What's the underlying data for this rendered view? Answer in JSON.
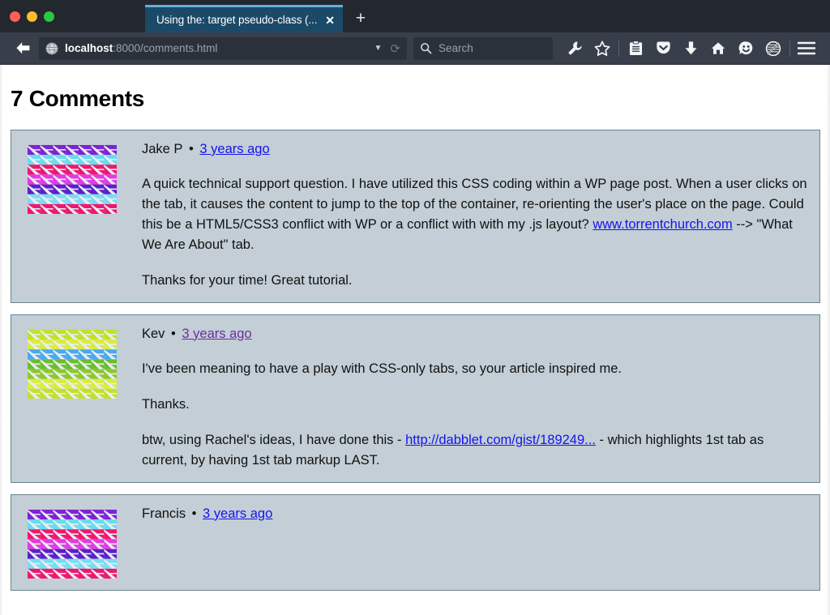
{
  "browser": {
    "traffic_lights": {
      "close_color": "#ff5f57",
      "minimize_color": "#febc2e",
      "maximize_color": "#28c840"
    },
    "tab": {
      "title": "Using the: target pseudo-class (...",
      "close_label": "✕",
      "accent_color": "#63b0db",
      "background_color": "#1b4a68"
    },
    "new_tab_label": "+",
    "back_icon": "back-arrow-icon",
    "url": {
      "host": "localhost",
      "path": ":8000/comments.html",
      "full": "localhost:8000/comments.html",
      "dropdown_icon": "▼",
      "reload_icon": "⟳"
    },
    "search": {
      "placeholder": "Search",
      "icon": "search-icon"
    },
    "toolbar_icons": [
      {
        "name": "wrench-icon",
        "glyph": "wrench"
      },
      {
        "name": "star-icon",
        "glyph": "star"
      },
      {
        "name": "reader-list-icon",
        "glyph": "clipboard"
      },
      {
        "name": "pocket-icon",
        "glyph": "pocket"
      },
      {
        "name": "downloads-icon",
        "glyph": "download-arrow"
      },
      {
        "name": "home-icon",
        "glyph": "home"
      },
      {
        "name": "smiley-feedback-icon",
        "glyph": "smiley"
      },
      {
        "name": "no-track-icon",
        "glyph": "circle-slash"
      },
      {
        "name": "menu-icon",
        "glyph": "hamburger"
      }
    ]
  },
  "page": {
    "title": "7 Comments",
    "comment_background": "#c3ced6",
    "comment_border": "#6b828f",
    "link_unvisited_color": "#1414ee",
    "link_visited_color": "#6b2fa0",
    "comments": [
      {
        "author": "Jake P",
        "separator": "•",
        "time_label": "3 years ago",
        "time_link_state": "unvisited",
        "avatar_name": "avatar-identicon-jake",
        "avatar_palette": [
          "#7d22d6",
          "#66dcf0",
          "#f0176f",
          "#e23be0",
          "#5c1fc9",
          "#7adcf2",
          "#f0176f"
        ],
        "paragraphs": [
          {
            "runs": [
              {
                "type": "text",
                "value": "A quick technical support question. I have utilized this CSS coding within a WP page post. When a user clicks on the tab, it causes the content to jump to the top of the container, re-orienting the user's place on the page. Could this be a HTML5/CSS3 conflict with WP or a conflict with with my .js layout? "
              },
              {
                "type": "link",
                "value": "www.torrentchurch.com",
                "state": "unvisited"
              },
              {
                "type": "text",
                "value": " --> \"What We Are About\" tab."
              }
            ]
          },
          {
            "runs": [
              {
                "type": "text",
                "value": "Thanks for your time! Great tutorial."
              }
            ]
          }
        ]
      },
      {
        "author": "Kev",
        "separator": "•",
        "time_label": "3 years ago",
        "time_link_state": "visited",
        "avatar_name": "avatar-identicon-kev",
        "avatar_palette": [
          "#c3e02a",
          "#d9ec3f",
          "#4aa8f0",
          "#6bbd2e",
          "#8dc72e",
          "#d9ec3f",
          "#c3e02a"
        ],
        "paragraphs": [
          {
            "runs": [
              {
                "type": "text",
                "value": "I've been meaning to have a play with CSS-only tabs, so your article inspired me."
              }
            ]
          },
          {
            "runs": [
              {
                "type": "text",
                "value": "Thanks."
              }
            ]
          },
          {
            "runs": [
              {
                "type": "text",
                "value": "btw, using Rachel's ideas, I have done this - "
              },
              {
                "type": "link",
                "value": "http://dabblet.com/gist/189249...",
                "state": "unvisited"
              },
              {
                "type": "text",
                "value": " - which highlights 1st tab as current, by having 1st tab markup LAST."
              }
            ]
          }
        ]
      },
      {
        "author": "Francis",
        "separator": "•",
        "time_label": "3 years ago",
        "time_link_state": "unvisited",
        "avatar_name": "avatar-identicon-francis",
        "avatar_palette": [
          "#7d22d6",
          "#66dcf0",
          "#f0176f",
          "#e23be0",
          "#5c1fc9",
          "#7adcf2",
          "#f0176f"
        ],
        "paragraphs": []
      }
    ]
  }
}
